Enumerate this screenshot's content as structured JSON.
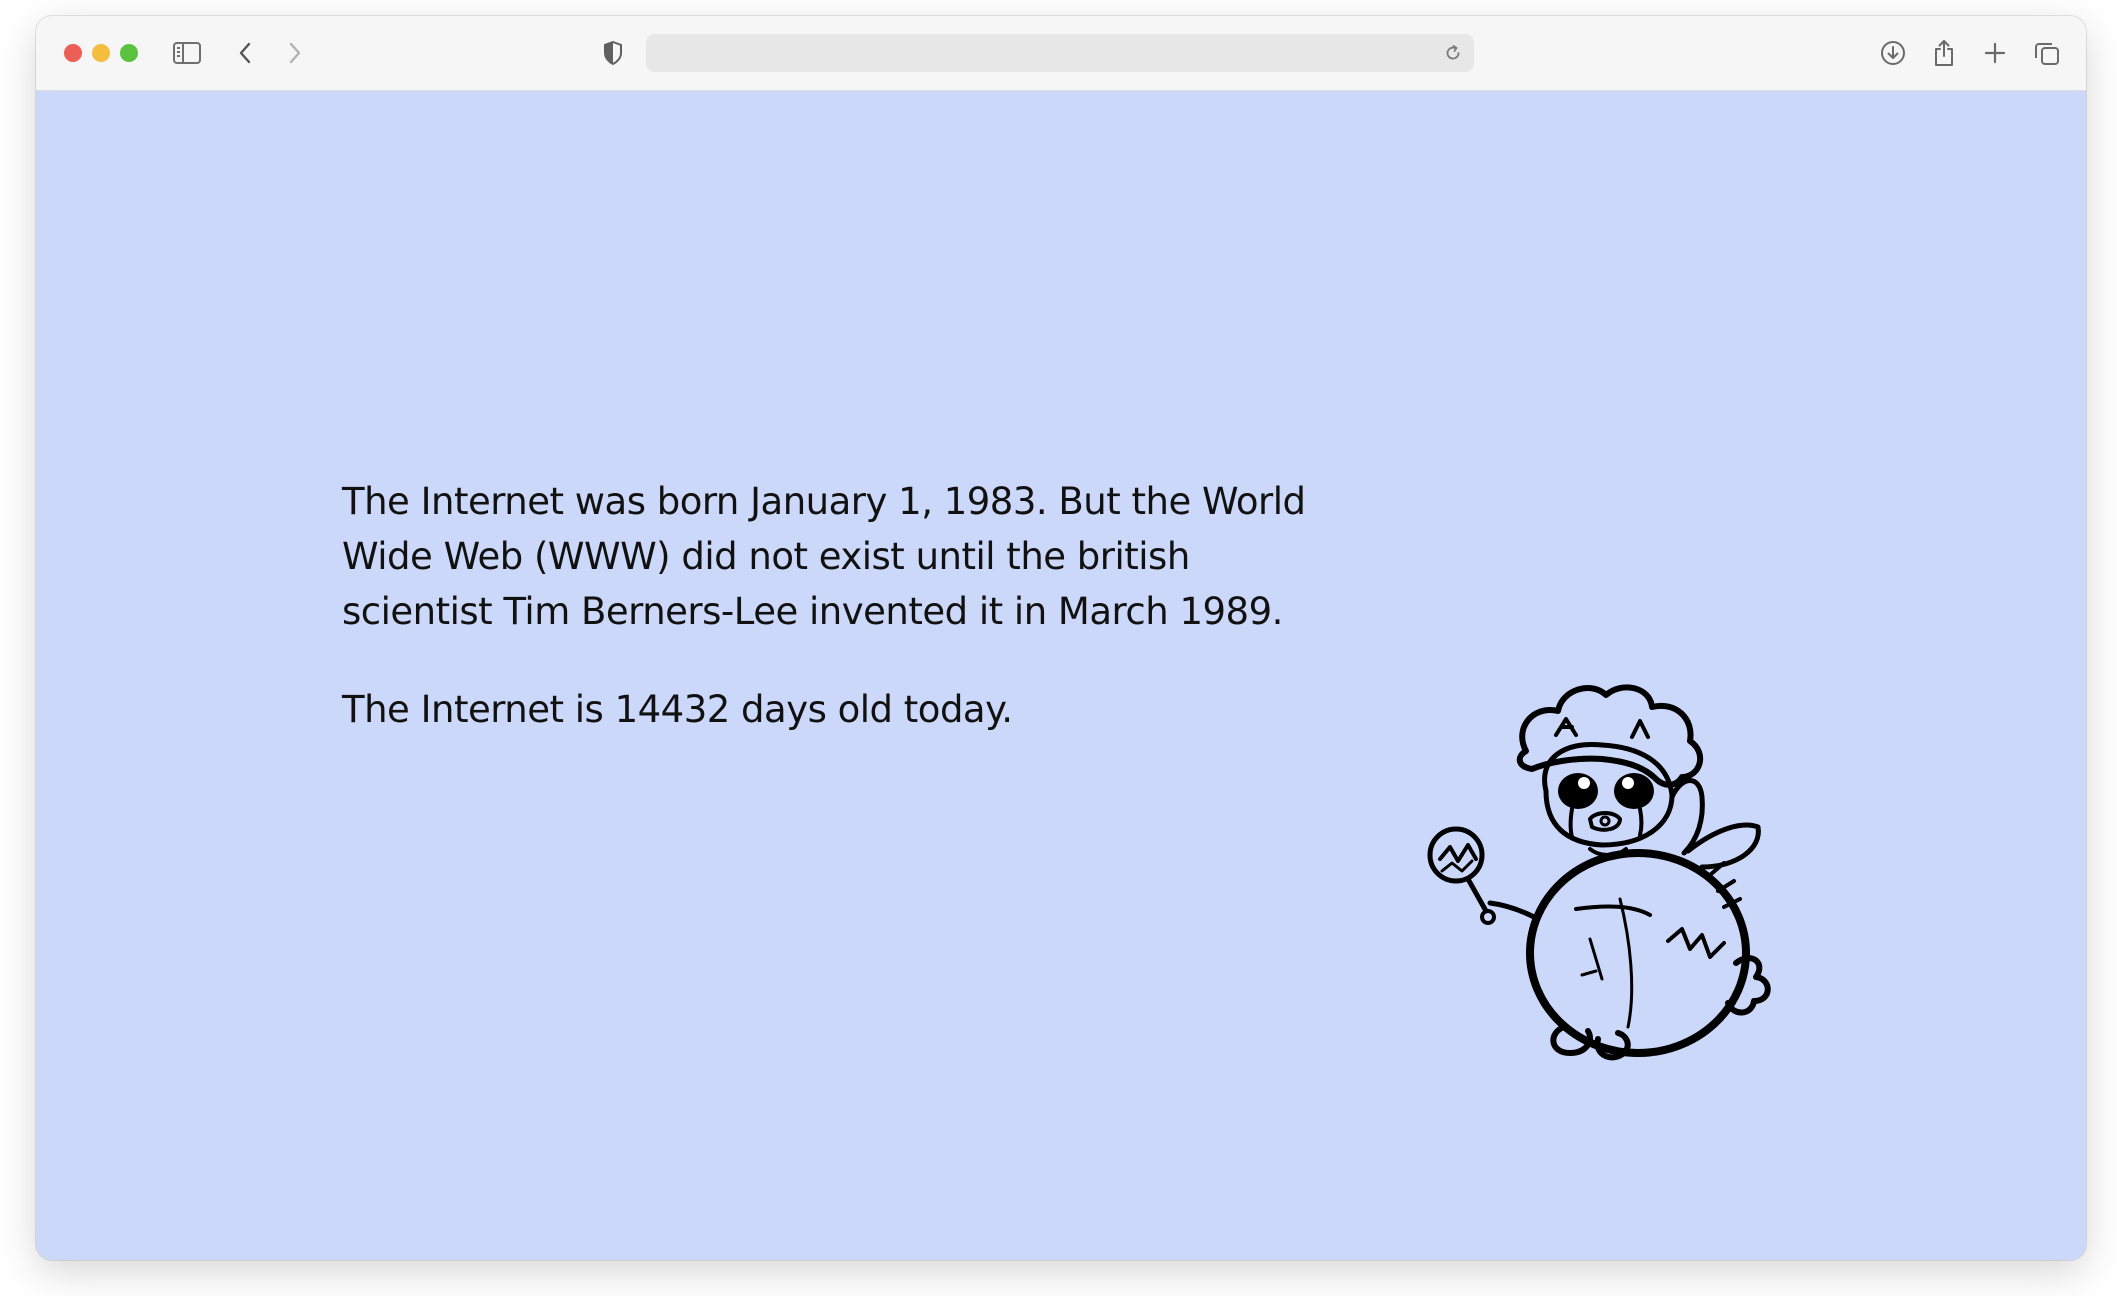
{
  "browser": {
    "url_value": "",
    "icons": [
      "sidebar-icon",
      "back-icon",
      "forward-icon",
      "shield-icon",
      "reload-icon",
      "download-icon",
      "share-icon",
      "new-tab-icon",
      "tabs-overview-icon"
    ]
  },
  "page": {
    "background_color": "#cbd8fa",
    "paragraph_1": "The Internet was born January 1, 1983. But the World Wide Web (WWW) did not exist until the british scientist Tim Berners-Lee invented it in March 1989.",
    "paragraph_2": "The Internet is 14432 days old today.",
    "illustration": "bee-mascot-drawing"
  }
}
